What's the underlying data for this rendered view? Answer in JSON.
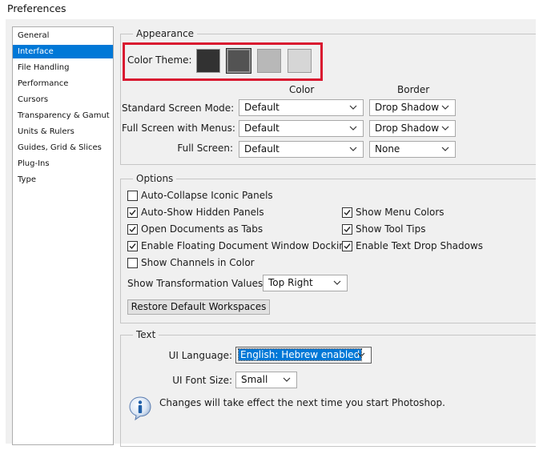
{
  "window_title": "Preferences",
  "sidebar": {
    "items": [
      {
        "label": "General",
        "active": false
      },
      {
        "label": "Interface",
        "active": true
      },
      {
        "label": "File Handling",
        "active": false
      },
      {
        "label": "Performance",
        "active": false
      },
      {
        "label": "Cursors",
        "active": false
      },
      {
        "label": "Transparency & Gamut",
        "active": false
      },
      {
        "label": "Units & Rulers",
        "active": false
      },
      {
        "label": "Guides, Grid & Slices",
        "active": false
      },
      {
        "label": "Plug-Ins",
        "active": false
      },
      {
        "label": "Type",
        "active": false
      }
    ]
  },
  "appearance": {
    "legend": "Appearance",
    "color_theme_label": "Color Theme:",
    "themes": [
      {
        "color": "#323232",
        "selected": false
      },
      {
        "color": "#535353",
        "selected": true
      },
      {
        "color": "#b8b8b8",
        "selected": false
      },
      {
        "color": "#d6d6d6",
        "selected": false
      }
    ],
    "col_color": "Color",
    "col_border": "Border",
    "modes": [
      {
        "label": "Standard Screen Mode:",
        "color": "Default",
        "border": "Drop Shadow"
      },
      {
        "label": "Full Screen with Menus:",
        "color": "Default",
        "border": "Drop Shadow"
      },
      {
        "label": "Full Screen:",
        "color": "Default",
        "border": "None"
      }
    ]
  },
  "options": {
    "legend": "Options",
    "checkboxes": [
      {
        "label": "Auto-Collapse Iconic Panels",
        "checked": false
      },
      {
        "label": "Auto-Show Hidden Panels",
        "checked": true
      },
      {
        "label": "Open Documents as Tabs",
        "checked": true
      },
      {
        "label": "Enable Floating Document Window Docking",
        "checked": true
      },
      {
        "label": "Show Channels in Color",
        "checked": false
      },
      {
        "label": "Show Menu Colors",
        "checked": true
      },
      {
        "label": "Show Tool Tips",
        "checked": true
      },
      {
        "label": "Enable Text Drop Shadows",
        "checked": true
      }
    ],
    "transform_label": "Show Transformation Values:",
    "transform_value": "Top Right",
    "restore_label": "Restore Default Workspaces"
  },
  "text": {
    "legend": "Text",
    "ui_language_label": "UI Language:",
    "ui_language_value": "English: Hebrew enabled",
    "ui_font_size_label": "UI Font Size:",
    "ui_font_size_value": "Small",
    "info_message": "Changes will take effect the next time you start Photoshop."
  },
  "colors": {
    "highlight_border": "#d9172f",
    "selection": "#0078d7"
  },
  "icons": {
    "chevron": "chevron-down-icon",
    "info": "info-icon",
    "checkmark": "checkmark-icon"
  }
}
